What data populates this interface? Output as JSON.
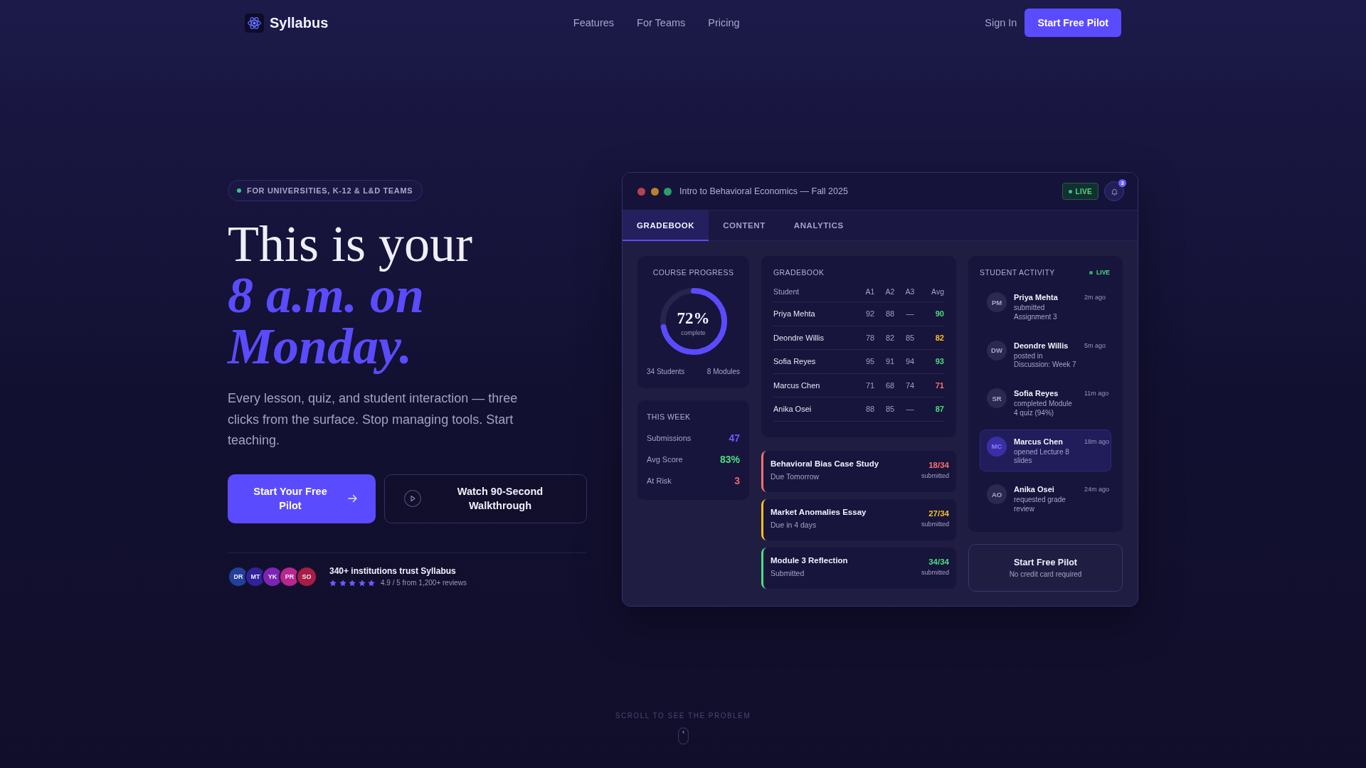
{
  "nav": {
    "brand": "Syllabus",
    "links": [
      "Features",
      "For Teams",
      "Pricing"
    ],
    "sign_in": "Sign In",
    "cta": "Start Free Pilot"
  },
  "hero": {
    "badge": "FOR UNIVERSITIES, K-12 & L&D TEAMS",
    "headline": "This is your *8 a.m. on Monday.*",
    "lead": "Every lesson, quiz, and student interaction — three clicks from the surface. Stop managing tools. Start teaching.",
    "primary_button": "Start Your Free Pilot",
    "secondary_button": "Watch 90-Second Walkthrough",
    "avatars": [
      {
        "initials": "DR",
        "color": "#22409a"
      },
      {
        "initials": "MT",
        "color": "#32229a"
      },
      {
        "initials": "YK",
        "color": "#7d24b5"
      },
      {
        "initials": "PR",
        "color": "#b8268f"
      },
      {
        "initials": "SO",
        "color": "#a81c45"
      }
    ],
    "trust": "340+ institutions trust Syllabus",
    "stars": 5,
    "rating": "4.9 / 5 from 1,200+ reviews"
  },
  "dashboard": {
    "title": "Intro to Behavioral Economics — Fall 2025",
    "live": "LIVE",
    "notifications": "3",
    "tabs": [
      {
        "label": "GRADEBOOK",
        "selected": true
      },
      {
        "label": "CONTENT",
        "selected": false
      },
      {
        "label": "ANALYTICS",
        "selected": false
      }
    ],
    "course_progress": {
      "title": "COURSE PROGRESS",
      "level": 0.72,
      "percent": "72%",
      "caption": "complete",
      "students": "34 Students",
      "modules": "8 Modules"
    },
    "this_week": {
      "title": "THIS WEEK",
      "stats": [
        {
          "label": "Submissions",
          "value": "47",
          "color": "#6b5cff"
        },
        {
          "label": "Avg Score",
          "value": "83%",
          "color": "#4ade80"
        },
        {
          "label": "At Risk",
          "value": "3",
          "color": "#f0606a"
        }
      ]
    },
    "gradebook": {
      "title": "GRADEBOOK",
      "columns": [
        "Student",
        "A1",
        "A2",
        "A3",
        "Avg"
      ],
      "rows": [
        {
          "student": "Priya Mehta",
          "scores": [
            "92",
            "88",
            "—"
          ],
          "avg": "90",
          "color": "#4ade80"
        },
        {
          "student": "Deondre Willis",
          "scores": [
            "78",
            "82",
            "85"
          ],
          "avg": "82",
          "color": "#fbbf24"
        },
        {
          "student": "Sofia Reyes",
          "scores": [
            "95",
            "91",
            "94"
          ],
          "avg": "93",
          "color": "#4ade80"
        },
        {
          "student": "Marcus Chen",
          "scores": [
            "71",
            "68",
            "74"
          ],
          "avg": "71",
          "color": "#f87171"
        },
        {
          "student": "Anika Osei",
          "scores": [
            "88",
            "85",
            "—"
          ],
          "avg": "87",
          "color": "#4ade80"
        }
      ]
    },
    "assignments": [
      {
        "title": "Behavioral Bias Case Study",
        "due": "Due Tomorrow",
        "count": "18/34",
        "count_label": "submitted",
        "color": "#f87171"
      },
      {
        "title": "Market Anomalies Essay",
        "due": "Due in 4 days",
        "count": "27/34",
        "count_label": "submitted",
        "color": "#fbbf24"
      },
      {
        "title": "Module 3 Reflection",
        "due": "Submitted",
        "count": "34/34",
        "count_label": "submitted",
        "color": "#4ade80"
      }
    ],
    "activity": {
      "title": "STUDENT ACTIVITY",
      "live": "LIVE",
      "items": [
        {
          "initials": "PM",
          "name": "Priya Mehta",
          "action": "submitted Assignment 3",
          "time": "2m ago",
          "highlighted": false
        },
        {
          "initials": "DW",
          "name": "Deondre Willis",
          "action": "posted in Discussion: Week 7",
          "time": "5m ago",
          "highlighted": false
        },
        {
          "initials": "SR",
          "name": "Sofia Reyes",
          "action": "completed Module 4 quiz (94%)",
          "time": "11m ago",
          "highlighted": false
        },
        {
          "initials": "MC",
          "name": "Marcus Chen",
          "action": "opened Lecture 8 slides",
          "time": "18m ago",
          "highlighted": true
        },
        {
          "initials": "AO",
          "name": "Anika Osei",
          "action": "requested grade review",
          "time": "24m ago",
          "highlighted": false
        }
      ]
    },
    "cta": {
      "title": "Start Free Pilot",
      "subtitle": "No credit card required"
    }
  },
  "scroll_hint": "SCROLL TO SEE THE PROBLEM"
}
